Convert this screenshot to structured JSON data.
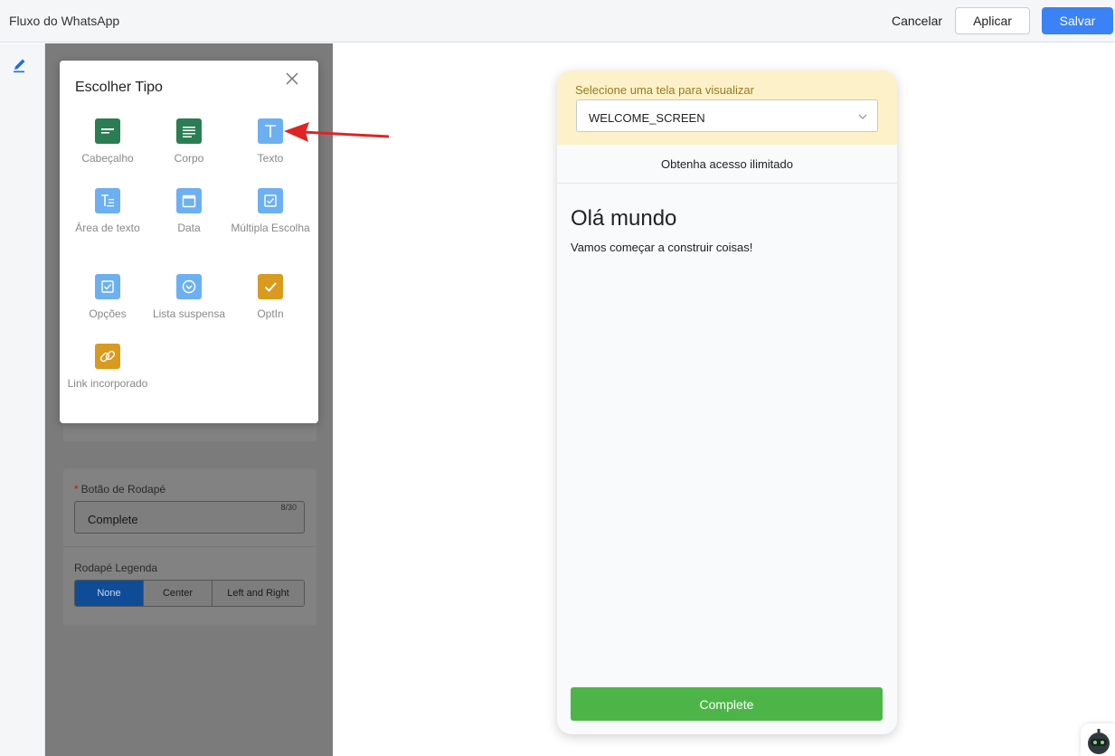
{
  "header": {
    "title": "Fluxo do WhatsApp",
    "cancel_label": "Cancelar",
    "apply_label": "Aplicar",
    "save_label": "Salvar"
  },
  "modal": {
    "title": "Escolher Tipo",
    "types": [
      {
        "label": "Cabeçalho",
        "icon": "header-icon",
        "color": "#2b7d53"
      },
      {
        "label": "Corpo",
        "icon": "body-text-icon",
        "color": "#2b7d53"
      },
      {
        "label": "Texto",
        "icon": "text-icon",
        "color": "#6cb0f2"
      },
      {
        "label": "Área de texto",
        "icon": "text-area-icon",
        "color": "#6cb0f2"
      },
      {
        "label": "Data",
        "icon": "calendar-icon",
        "color": "#6cb0f2"
      },
      {
        "label": "Múltipla Escolha",
        "icon": "checkbox-icon",
        "color": "#6cb0f2"
      },
      {
        "label": "Opções",
        "icon": "checkbox-icon",
        "color": "#6cb0f2"
      },
      {
        "label": "Lista suspensa",
        "icon": "dropdown-icon",
        "color": "#6cb0f2"
      },
      {
        "label": "OptIn",
        "icon": "checkmark-icon",
        "color": "#d89b1f"
      },
      {
        "label": "Link incorporado",
        "icon": "link-icon",
        "color": "#d89b1f"
      }
    ]
  },
  "footer_settings": {
    "footer_button_label": "Botão de Rodapé",
    "footer_button_value": "Complete",
    "footer_button_count": "8/30",
    "caption_label": "Rodapé Legenda",
    "caption_options": [
      "None",
      "Center",
      "Left and Right"
    ],
    "caption_selected": "None"
  },
  "preview": {
    "select_label": "Selecione uma tela para visualizar",
    "selected_screen": "WELCOME_SCREEN",
    "screen_title": "Obtenha acesso ilimitado",
    "heading": "Olá mundo",
    "body": "Vamos começar a construir coisas!",
    "complete_label": "Complete"
  },
  "colors": {
    "primary": "#3b82f6",
    "complete_green": "#4db548",
    "preview_header": "#fdf1c9",
    "arrow_red": "#e02424"
  }
}
